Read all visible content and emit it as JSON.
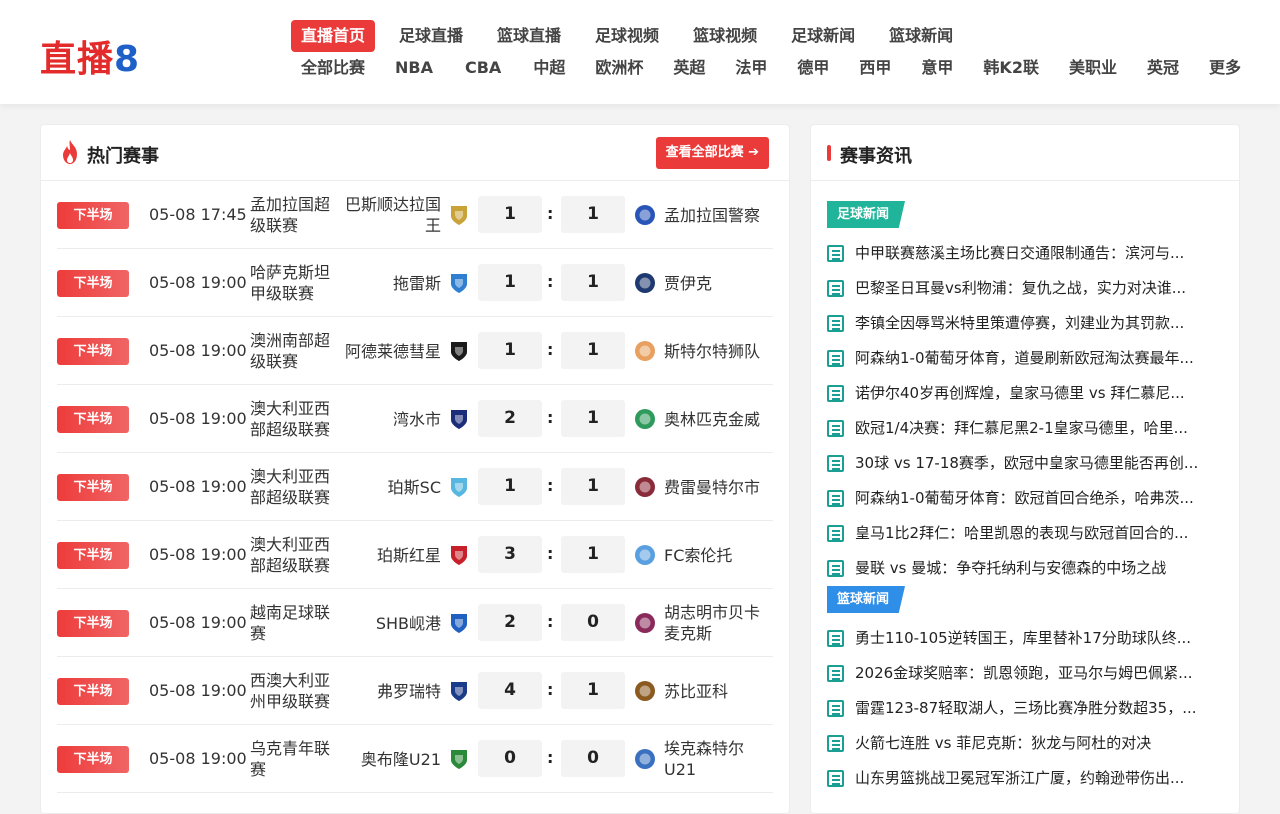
{
  "logo": {
    "part1": "直播",
    "part2": "8"
  },
  "nav_primary": [
    "直播首页",
    "足球直播",
    "篮球直播",
    "足球视频",
    "篮球视频",
    "足球新闻",
    "篮球新闻"
  ],
  "nav_secondary": [
    "全部比赛",
    "NBA",
    "CBA",
    "中超",
    "欧洲杯",
    "英超",
    "法甲",
    "德甲",
    "西甲",
    "意甲",
    "韩K2联",
    "美职业",
    "英冠",
    "更多"
  ],
  "hot": {
    "title": "热门赛事",
    "all_button": "查看全部比赛 ➔",
    "matches": [
      {
        "status": "下半场",
        "time": "05-08 17:45",
        "league": "孟加拉国超级联赛",
        "home": "巴斯顺达拉国王",
        "home_score": "1",
        "away_score": "1",
        "away": "孟加拉国警察",
        "home_color": "#c9a23a",
        "away_color": "#2a55b8"
      },
      {
        "status": "下半场",
        "time": "05-08 19:00",
        "league": "哈萨克斯坦甲级联赛",
        "home": "拖雷斯",
        "home_score": "1",
        "away_score": "1",
        "away": "贾伊克",
        "home_color": "#2f7fd0",
        "away_color": "#1f3a70"
      },
      {
        "status": "下半场",
        "time": "05-08 19:00",
        "league": "澳洲南部超级联赛",
        "home": "阿德莱德彗星",
        "home_score": "1",
        "away_score": "1",
        "away": "斯特尔特狮队",
        "home_color": "#1a1a1a",
        "away_color": "#e8a060"
      },
      {
        "status": "下半场",
        "time": "05-08 19:00",
        "league": "澳大利亚西部超级联赛",
        "home": "湾水市",
        "home_score": "2",
        "away_score": "1",
        "away": "奥林匹克金威",
        "home_color": "#1c2d7a",
        "away_color": "#2e9a5b"
      },
      {
        "status": "下半场",
        "time": "05-08 19:00",
        "league": "澳大利亚西部超级联赛",
        "home": "珀斯SC",
        "home_score": "1",
        "away_score": "1",
        "away": "费雷曼特尔市",
        "home_color": "#57b7e0",
        "away_color": "#8a2b3a"
      },
      {
        "status": "下半场",
        "time": "05-08 19:00",
        "league": "澳大利亚西部超级联赛",
        "home": "珀斯红星",
        "home_score": "3",
        "away_score": "1",
        "away": "FC索伦托",
        "home_color": "#c8202a",
        "away_color": "#5aa0e0"
      },
      {
        "status": "下半场",
        "time": "05-08 19:00",
        "league": "越南足球联赛",
        "home": "SHB岘港",
        "home_score": "2",
        "away_score": "0",
        "away": "胡志明市贝卡麦克斯",
        "home_color": "#2060c0",
        "away_color": "#8a2a5a"
      },
      {
        "status": "下半场",
        "time": "05-08 19:00",
        "league": "西澳大利亚州甲级联赛",
        "home": "弗罗瑞特",
        "home_score": "4",
        "away_score": "1",
        "away": "苏比亚科",
        "home_color": "#1a3a8a",
        "away_color": "#8a5a20"
      },
      {
        "status": "下半场",
        "time": "05-08 19:00",
        "league": "乌克青年联赛",
        "home": "奥布隆U21",
        "home_score": "0",
        "away_score": "0",
        "away": "埃克森特尔U21",
        "home_color": "#2a8a3a",
        "away_color": "#3a70c0"
      }
    ]
  },
  "news": {
    "title": "赛事资讯",
    "sections": [
      {
        "tag": "足球新闻",
        "items": [
          "中甲联赛慈溪主场比赛日交通限制通告：滨河与...",
          "巴黎圣日耳曼vs利物浦：复仇之战，实力对决谁...",
          "李镇全因辱骂米特里策遭停赛，刘建业为其罚款...",
          "阿森纳1-0葡萄牙体育，道曼刷新欧冠淘汰赛最年...",
          "诺伊尔40岁再创辉煌，皇家马德里 vs 拜仁慕尼...",
          "欧冠1/4决赛：拜仁慕尼黑2-1皇家马德里，哈里...",
          "30球 vs 17-18赛季，欧冠中皇家马德里能否再创...",
          "阿森纳1-0葡萄牙体育：欧冠首回合绝杀，哈弗茨...",
          "皇马1比2拜仁：哈里凯恩的表现与欧冠首回合的...",
          "曼联 vs 曼城：争夺托纳利与安德森的中场之战"
        ]
      },
      {
        "tag": "篮球新闻",
        "items": [
          "勇士110-105逆转国王，库里替补17分助球队终...",
          "2026金球奖赔率：凯恩领跑，亚马尔与姆巴佩紧...",
          "雷霆123-87轻取湖人，三场比赛净胜分数超35，...",
          "火箭七连胜 vs 菲尼克斯：狄龙与阿杜的对决",
          "山东男篮挑战卫冕冠军浙江广厦，约翰逊带伤出..."
        ]
      }
    ]
  }
}
